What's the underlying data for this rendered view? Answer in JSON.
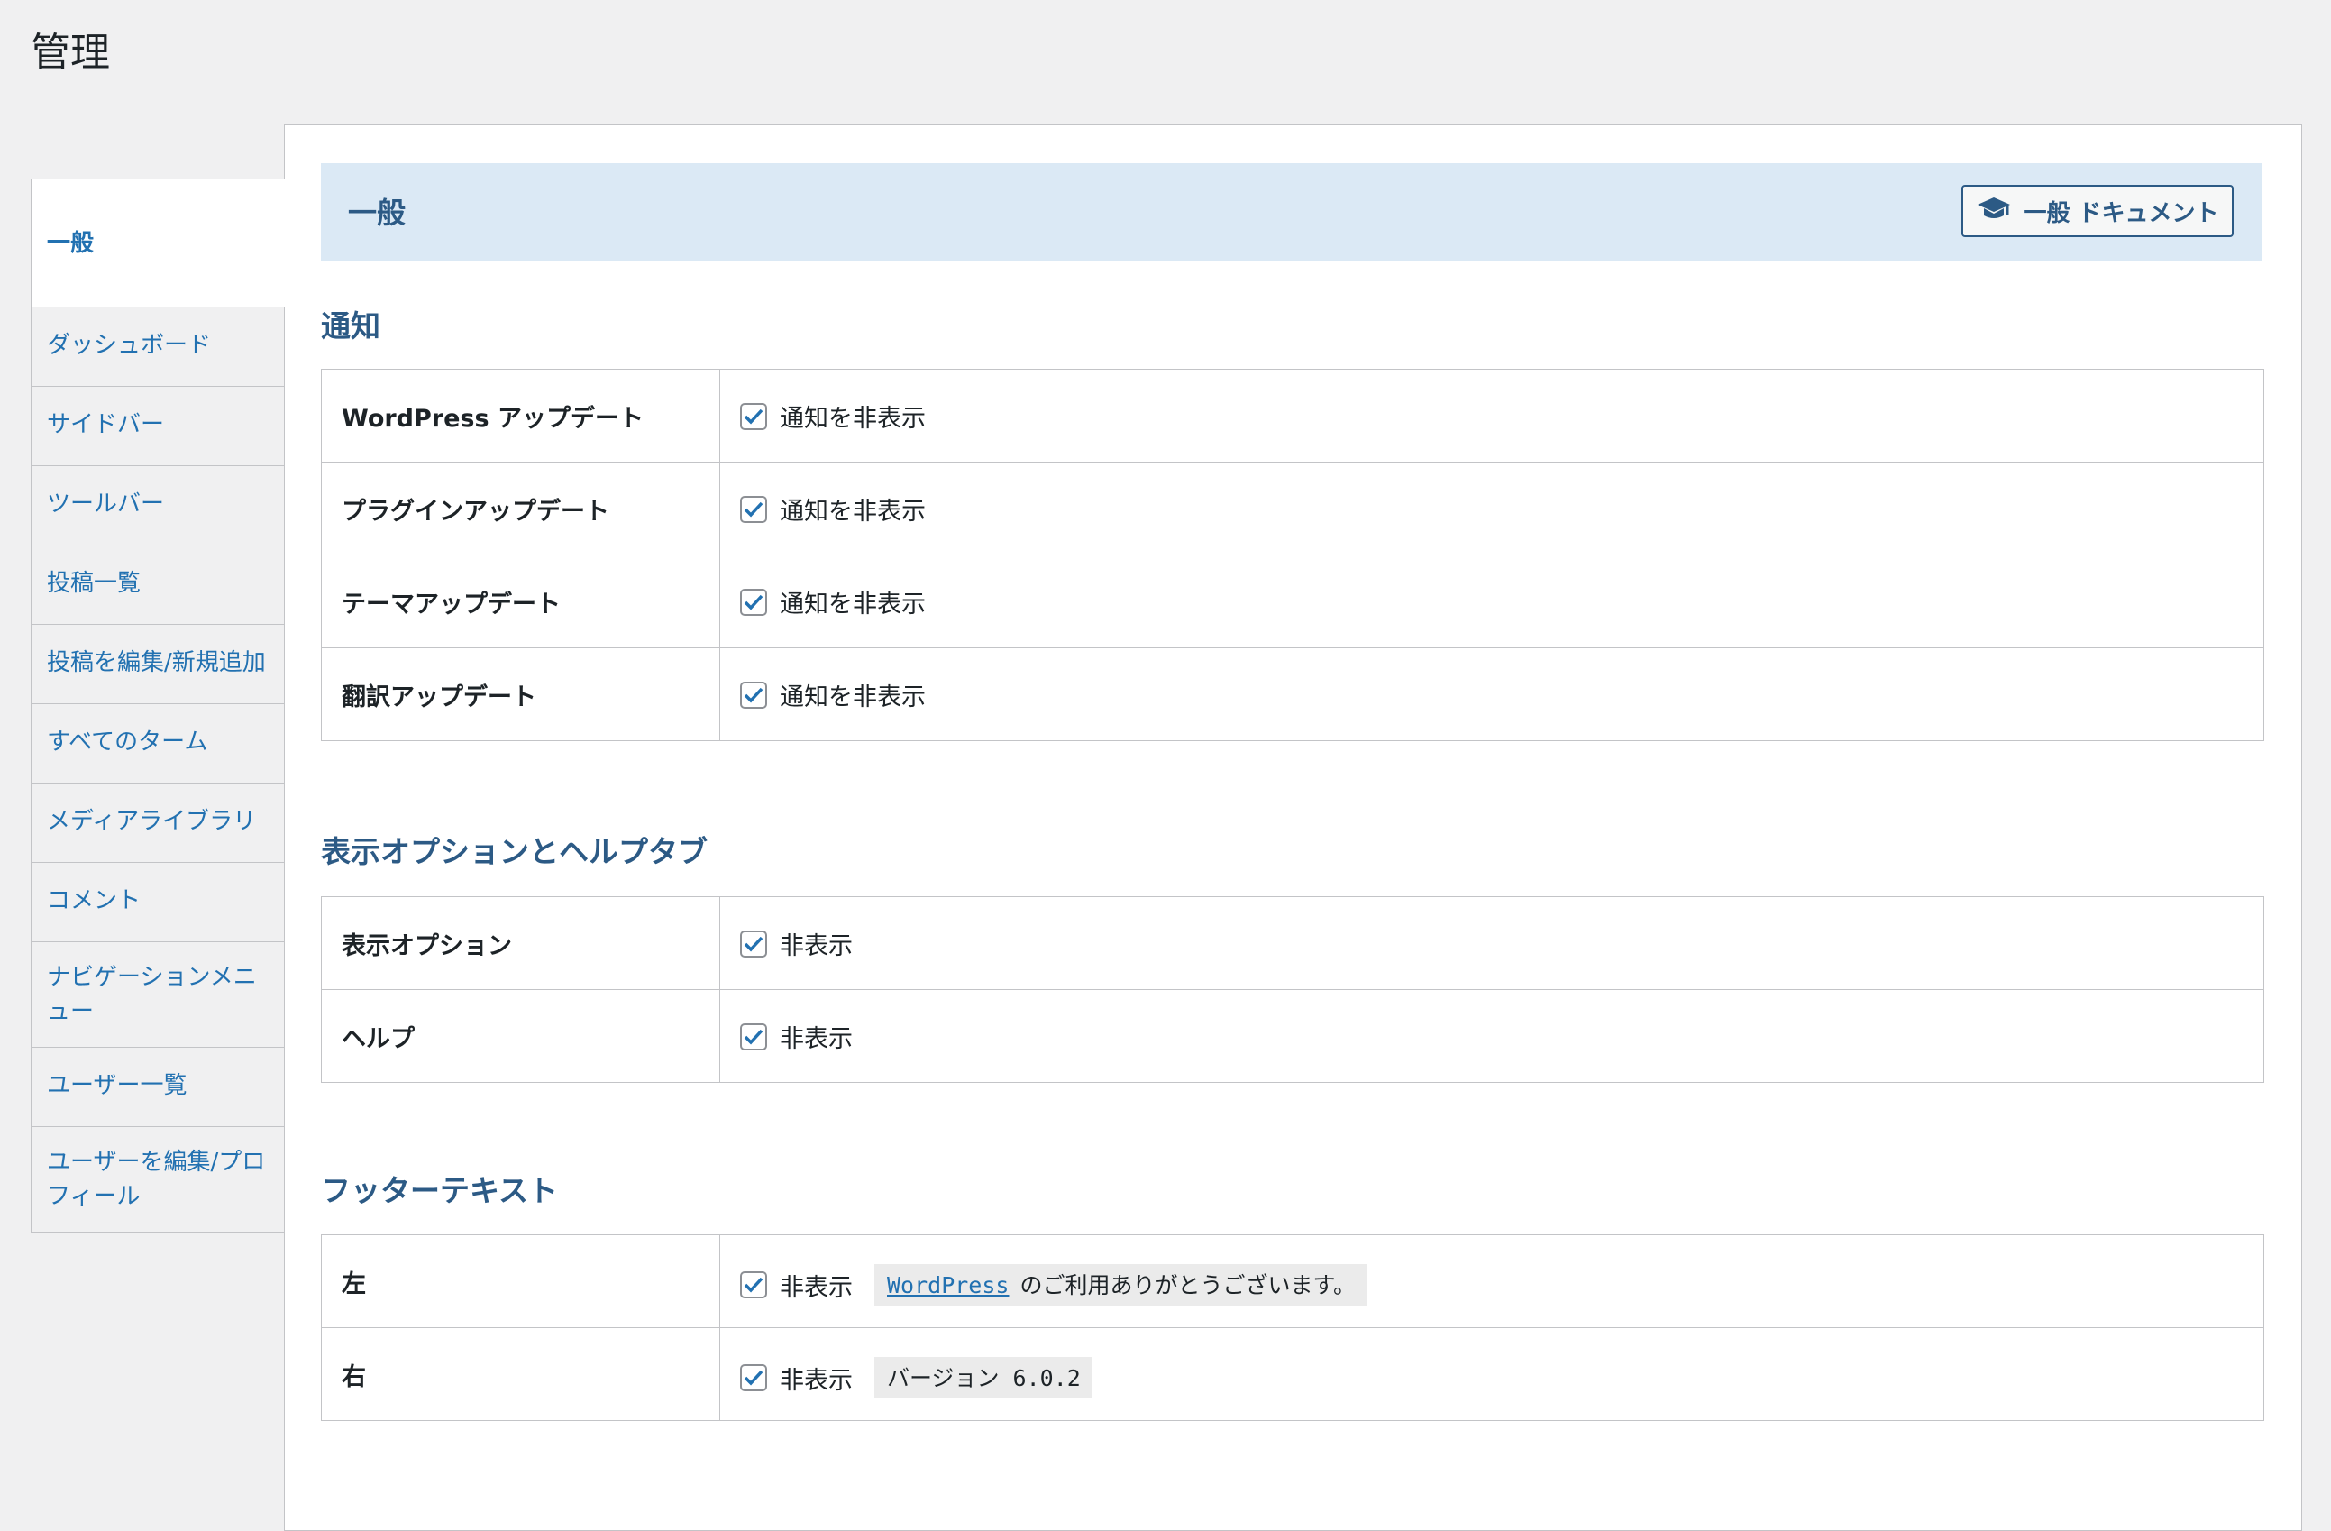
{
  "page": {
    "title": "管理"
  },
  "tabs": [
    {
      "label": "一般",
      "active": true
    },
    {
      "label": "ダッシュボード"
    },
    {
      "label": "サイドバー"
    },
    {
      "label": "ツールバー"
    },
    {
      "label": "投稿一覧"
    },
    {
      "label": "投稿を編集/新規追加"
    },
    {
      "label": "すべてのターム"
    },
    {
      "label": "メディアライブラリ"
    },
    {
      "label": "コメント"
    },
    {
      "label": "ナビゲーションメニュー"
    },
    {
      "label": "ユーザー一覧"
    },
    {
      "label": "ユーザーを編集/プロフィール"
    }
  ],
  "banner": {
    "title": "一般",
    "doc_button": "一般 ドキュメント",
    "doc_icon": "graduation-cap-icon"
  },
  "sections": {
    "notifications": {
      "heading": "通知",
      "rows": [
        {
          "label": "WordPress アップデート",
          "checkbox": "通知を非表示",
          "checked": true
        },
        {
          "label": "プラグインアップデート",
          "checkbox": "通知を非表示",
          "checked": true
        },
        {
          "label": "テーマアップデート",
          "checkbox": "通知を非表示",
          "checked": true
        },
        {
          "label": "翻訳アップデート",
          "checkbox": "通知を非表示",
          "checked": true
        }
      ]
    },
    "screen_options": {
      "heading": "表示オプションとヘルプタブ",
      "rows": [
        {
          "label": "表示オプション",
          "checkbox": "非表示",
          "checked": true
        },
        {
          "label": "ヘルプ",
          "checkbox": "非表示",
          "checked": true
        }
      ]
    },
    "footer_text": {
      "heading": "フッターテキスト",
      "rows": [
        {
          "label": "左",
          "checkbox": "非表示",
          "checked": true,
          "code_link": "WordPress",
          "code_text": "のご利用ありがとうございます。"
        },
        {
          "label": "右",
          "checkbox": "非表示",
          "checked": true,
          "code_text": "バージョン 6.0.2"
        }
      ]
    }
  },
  "colors": {
    "accent": "#2271b1",
    "heading": "#2c5a85",
    "banner_bg": "#dbe9f5",
    "page_bg": "#f0f0f1"
  }
}
